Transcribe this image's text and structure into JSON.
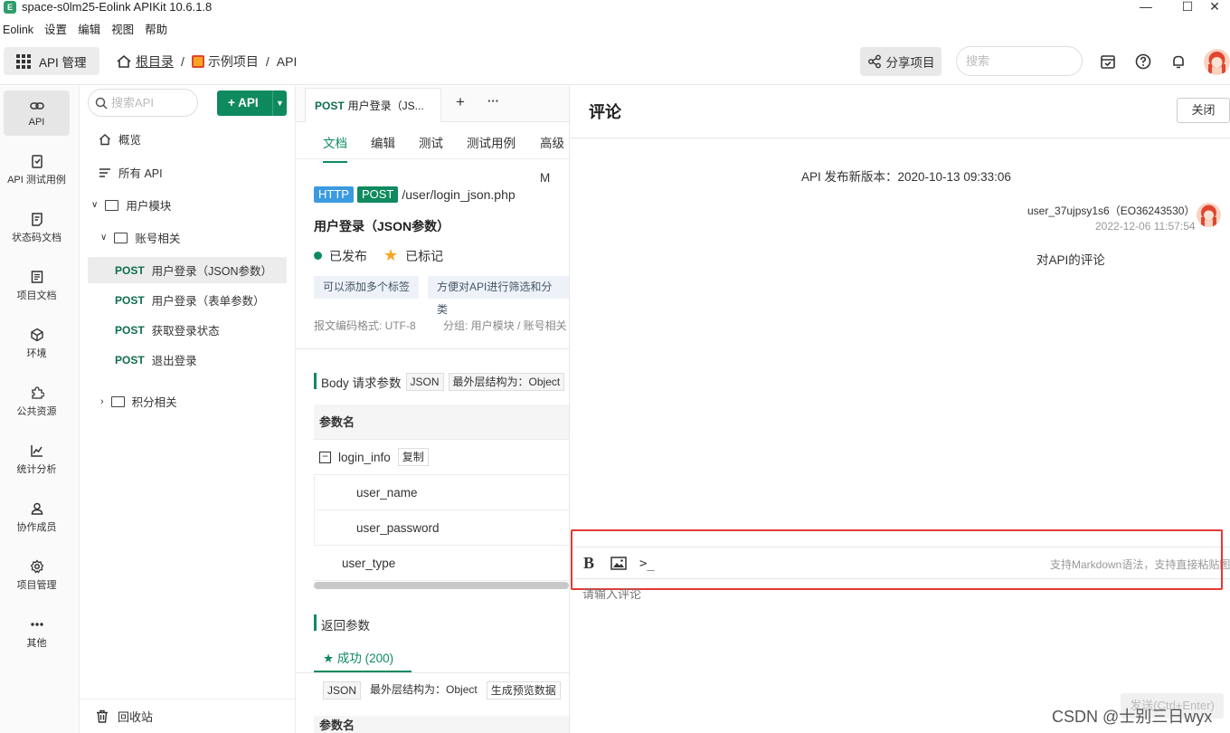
{
  "window": {
    "title": "space-s0lm25-Eolink APIKit 10.6.1.8",
    "logo_letter": "E",
    "minimize": "—",
    "maximize": "☐",
    "close": "✕"
  },
  "menu": [
    "Eolink",
    "设置",
    "编辑",
    "视图",
    "帮助"
  ],
  "header": {
    "module_button": "API 管理",
    "breadcrumb": {
      "root": "根目录",
      "sep1": "/",
      "project": "示例项目",
      "sep2": "/",
      "current": "API"
    },
    "share_button": "分享项目",
    "search_placeholder": "搜索"
  },
  "leftnav": [
    {
      "label": "API",
      "icon": "link-icon"
    },
    {
      "label": "API 测试用例",
      "icon": "test-case-icon"
    },
    {
      "label": "状态码文档",
      "icon": "status-code-icon"
    },
    {
      "label": "项目文档",
      "icon": "document-icon"
    },
    {
      "label": "环境",
      "icon": "environment-icon"
    },
    {
      "label": "公共资源",
      "icon": "puzzle-icon"
    },
    {
      "label": "统计分析",
      "icon": "chart-icon"
    },
    {
      "label": "协作成员",
      "icon": "members-icon"
    },
    {
      "label": "项目管理",
      "icon": "gear-icon"
    },
    {
      "label": "其他",
      "icon": "more-icon"
    }
  ],
  "tree": {
    "search_placeholder": "搜索API",
    "add_button": "+ API",
    "overview": "概览",
    "all_api": "所有 API",
    "folder_user": "用户模块",
    "folder_account": "账号相关",
    "apis": [
      {
        "method": "POST",
        "name": "用户登录（JSON参数）"
      },
      {
        "method": "POST",
        "name": "用户登录（表单参数）"
      },
      {
        "method": "POST",
        "name": "获取登录状态"
      },
      {
        "method": "POST",
        "name": "退出登录"
      }
    ],
    "folder_points": "积分相关",
    "recycle": "回收站"
  },
  "doc": {
    "open_tab_method": "POST",
    "open_tab_name": "用户登录（JS...",
    "tab_add": "+",
    "tab_more": "···",
    "subtabs": [
      "文档",
      "编辑",
      "测试",
      "测试用例",
      "高级M"
    ],
    "protocol": "HTTP",
    "method": "POST",
    "path": "/user/login_json.php",
    "api_name": "用户登录（JSON参数）",
    "status": "已发布",
    "starred": "已标记",
    "tags": [
      "可以添加多个标签",
      "方便对API进行筛选和分类"
    ],
    "encoding": "报文编码格式: UTF-8",
    "group": "分组: 用户模块 / 账号相关",
    "body_title": "Body 请求参数",
    "body_format": "JSON",
    "body_outer": "最外层结构为：Object",
    "param_header": "参数名",
    "params": {
      "login_info": "login_info",
      "copy": "复制",
      "user_name": "user_name",
      "user_password": "user_password",
      "user_type": "user_type"
    },
    "return_title": "返回参数",
    "success_tab": "成功 (200)",
    "return_format": "JSON",
    "return_outer": "最外层结构为：Object",
    "gen_preview": "生成预览数据",
    "param_header2": "参数名"
  },
  "comments": {
    "title": "评论",
    "close_button": "关闭",
    "version_line": "API 发布新版本：2020-10-13 09:33:06",
    "user": "user_37ujpsy1s6（EO36243530）",
    "time": "2022-12-06 11:57:54",
    "body": "对API的评论",
    "tool_bold": "B",
    "tool_code": ">_",
    "markdown_hint": "支持Markdown语法，支持直接粘贴图片",
    "input_placeholder": "请输入评论",
    "send_button": "发送(Ctrl+Enter)"
  },
  "watermark": "CSDN @士别三日wyx",
  "colors": {
    "primary": "#0f8a5f",
    "highlight_box": "#e53935",
    "http_badge": "#3a9be0"
  }
}
